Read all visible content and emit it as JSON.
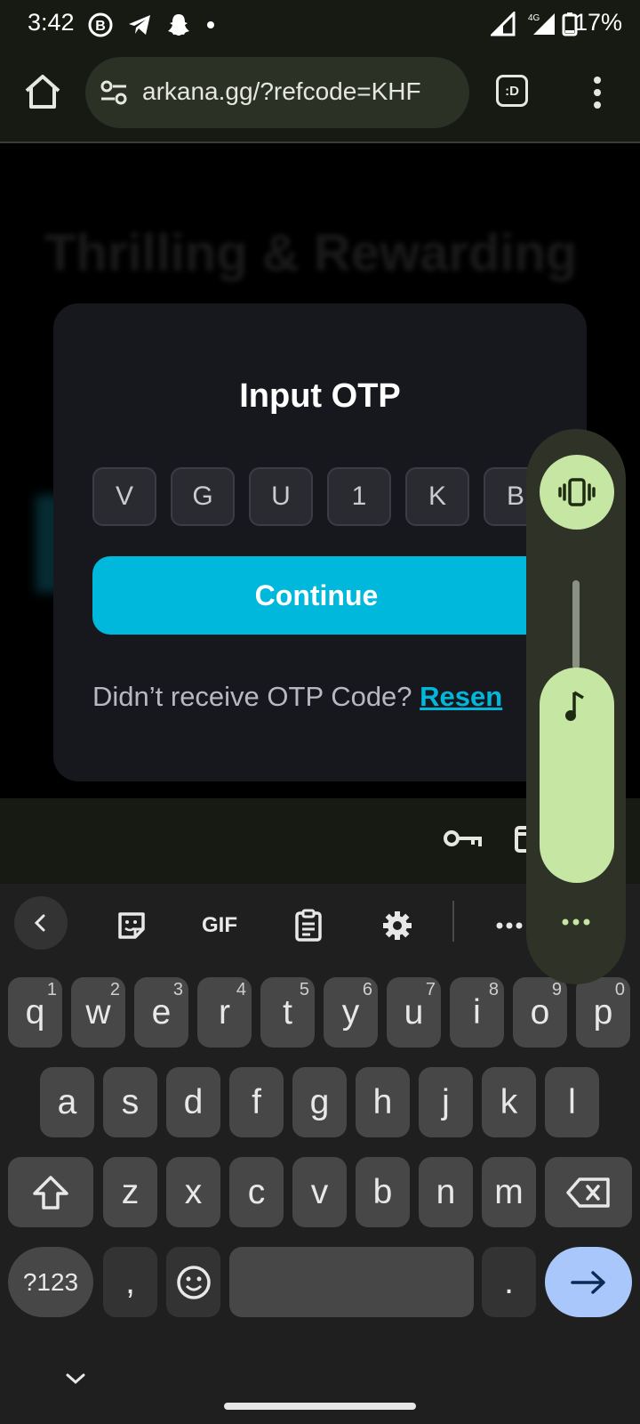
{
  "status_bar": {
    "time": "3:42",
    "network": "4G",
    "battery_percent": "17%"
  },
  "browser": {
    "url": "arkana.gg/?refcode=KHF",
    "tab_switcher_label": ":D"
  },
  "page": {
    "background_heading": "Thrilling & Rewarding",
    "modal": {
      "title": "Input OTP",
      "otp_digits": [
        "V",
        "G",
        "U",
        "1",
        "K",
        "B"
      ],
      "continue_label": "Continue",
      "resend_prompt": "Didn’t receive OTP Code?",
      "resend_link": "Resen"
    }
  },
  "keyboard": {
    "toolbar": [
      "back-icon",
      "sticker-icon",
      "GIF",
      "clipboard-icon",
      "gear-icon",
      "more-icon"
    ],
    "gif_label": "GIF",
    "row1": [
      {
        "k": "q",
        "h": "1"
      },
      {
        "k": "w",
        "h": "2"
      },
      {
        "k": "e",
        "h": "3"
      },
      {
        "k": "r",
        "h": "4"
      },
      {
        "k": "t",
        "h": "5"
      },
      {
        "k": "y",
        "h": "6"
      },
      {
        "k": "u",
        "h": "7"
      },
      {
        "k": "i",
        "h": "8"
      },
      {
        "k": "o",
        "h": "9"
      },
      {
        "k": "p",
        "h": "0"
      }
    ],
    "row2": [
      "a",
      "s",
      "d",
      "f",
      "g",
      "h",
      "j",
      "k",
      "l"
    ],
    "row3": [
      "z",
      "x",
      "c",
      "v",
      "b",
      "n",
      "m"
    ],
    "symbols_label": "?123",
    "comma_label": ",",
    "period_label": "."
  },
  "volume_panel": {
    "ringer_mode": "vibrate",
    "media_volume_fraction": 0.55
  },
  "colors": {
    "accent": "#00b8db",
    "volume_accent": "#c6e7a3",
    "modal_bg": "#17181d"
  }
}
